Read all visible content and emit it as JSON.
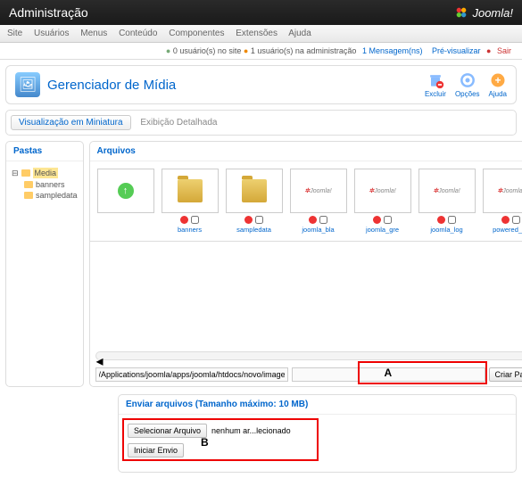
{
  "header": {
    "title": "Administração",
    "brand": "Joomla!"
  },
  "menu": [
    "Site",
    "Usuários",
    "Menus",
    "Conteúdo",
    "Componentes",
    "Extensões",
    "Ajuda"
  ],
  "status": {
    "visitors": "0 usuário(s) no site",
    "admins": "1 usuário(s) na administração",
    "messages": "1 Mensagem(ns)",
    "preview": "Pré-visualizar",
    "logout": "Sair"
  },
  "page": {
    "title": "Gerenciador de Mídia"
  },
  "toolbar": {
    "delete": "Excluir",
    "options": "Opções",
    "help": "Ajuda"
  },
  "tabs": {
    "thumb": "Visualização em Miniatura",
    "detail": "Exibição Detalhada"
  },
  "folders": {
    "heading": "Pastas",
    "root": "Media",
    "children": [
      "banners",
      "sampledata"
    ]
  },
  "files": {
    "heading": "Arquivos",
    "items": [
      {
        "name": "banners",
        "type": "folder"
      },
      {
        "name": "sampledata",
        "type": "folder"
      },
      {
        "name": "joomla_bla",
        "type": "logo"
      },
      {
        "name": "joomla_gre",
        "type": "logo"
      },
      {
        "name": "joomla_log",
        "type": "logo"
      },
      {
        "name": "powered_by",
        "type": "logo"
      }
    ],
    "path": "/Applications/joomla/apps/joomla/htdocs/novo/images",
    "create_folder": "Criar Pasta"
  },
  "upload": {
    "heading": "Enviar arquivos (Tamanho máximo: 10 MB)",
    "select": "Selecionar Arquivo",
    "nofile": "nenhum ar...lecionado",
    "start": "Iniciar Envio"
  },
  "annotations": {
    "a": "A",
    "b": "B"
  }
}
